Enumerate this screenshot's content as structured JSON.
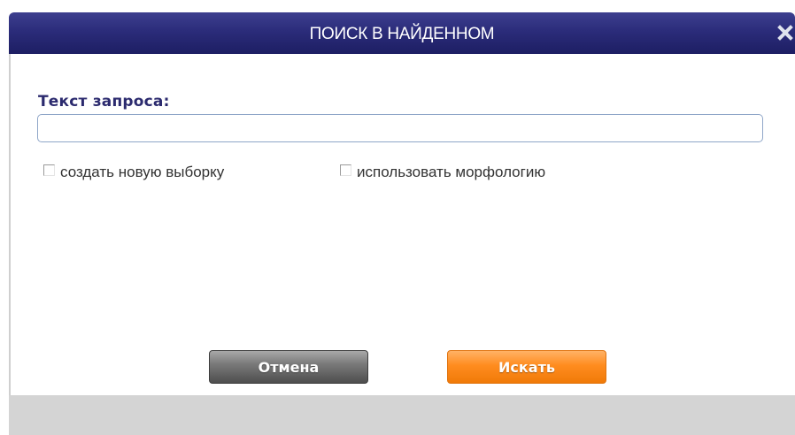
{
  "dialog": {
    "title": "ПОИСК В НАЙДЕННОМ",
    "close_icon": "close-icon"
  },
  "form": {
    "query_label": "Текст запроса:",
    "query_value": "",
    "query_placeholder": "",
    "checkboxes": [
      {
        "label": "создать новую выборку",
        "checked": false
      },
      {
        "label": "использовать морфологию",
        "checked": false
      }
    ]
  },
  "buttons": {
    "cancel_label": "Отмена",
    "search_label": "Искать"
  },
  "colors": {
    "titlebar": "#2b2c7a",
    "label": "#2b2a6e",
    "cancel_button": "#6e6e6e",
    "search_button": "#ff8c1f",
    "footer": "#d4d4d4"
  }
}
